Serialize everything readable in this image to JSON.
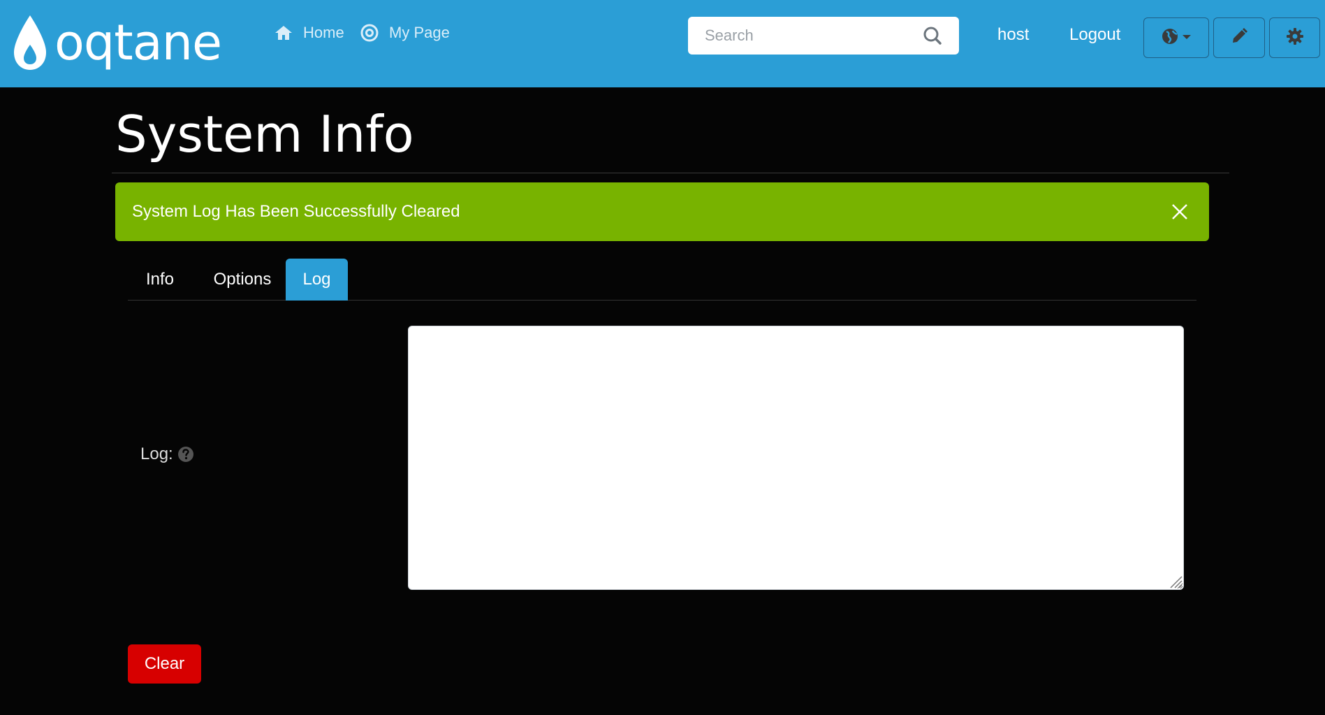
{
  "brand": {
    "logo_text": "oqtane",
    "logo_icon": "droplet-icon"
  },
  "nav": {
    "links": [
      {
        "label": "Home",
        "icon": "home-icon"
      },
      {
        "label": "My Page",
        "icon": "target-icon"
      }
    ]
  },
  "search": {
    "placeholder": "Search",
    "value": "",
    "icon": "search-icon"
  },
  "user": {
    "name": "host",
    "logout_label": "Logout"
  },
  "toolbar": {
    "language_icon": "globe-icon",
    "edit_icon": "pencil-icon",
    "settings_icon": "gear-icon"
  },
  "page": {
    "title": "System Info"
  },
  "alert": {
    "message": "System Log Has Been Successfully Cleared",
    "status_color": "#78b300"
  },
  "tabs": [
    {
      "label": "Info",
      "active": false
    },
    {
      "label": "Options",
      "active": false
    },
    {
      "label": "Log",
      "active": true
    }
  ],
  "log": {
    "label": "Log:",
    "value": ""
  },
  "actions": {
    "clear_label": "Clear"
  },
  "colors": {
    "navbar": "#2b9ed6",
    "background": "#050505",
    "danger": "#d70000"
  }
}
